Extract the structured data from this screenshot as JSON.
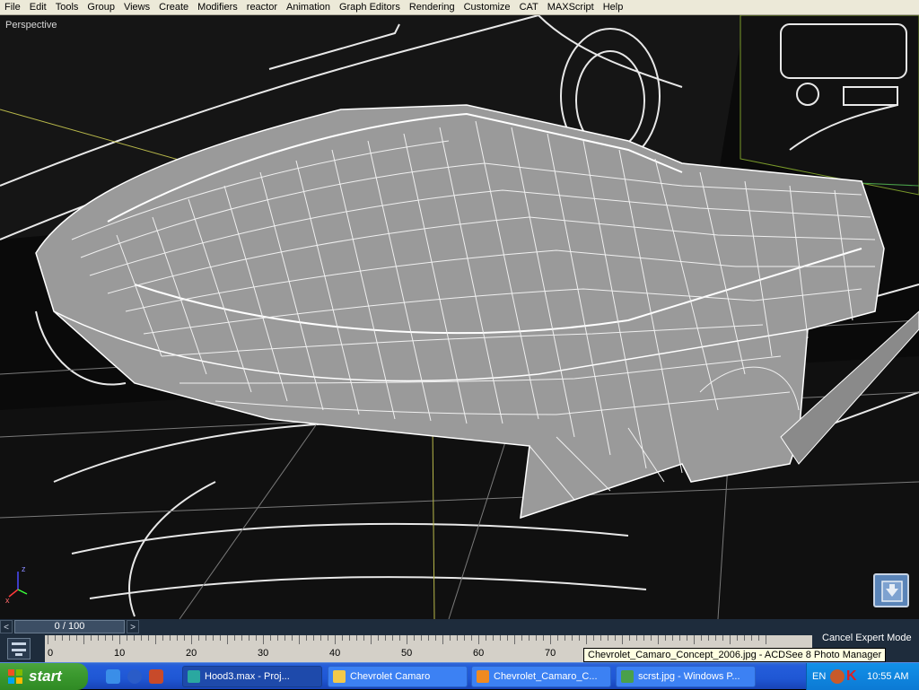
{
  "menu": [
    "File",
    "Edit",
    "Tools",
    "Group",
    "Views",
    "Create",
    "Modifiers",
    "reactor",
    "Animation",
    "Graph Editors",
    "Rendering",
    "Customize",
    "CAT",
    "MAXScript",
    "Help"
  ],
  "viewport": {
    "label": "Perspective"
  },
  "timeslider": {
    "position": "0 / 100",
    "prev": "<",
    "next": ">"
  },
  "trackbar": {
    "ticks": [
      "0",
      "10",
      "20",
      "30",
      "40",
      "50",
      "60",
      "70"
    ]
  },
  "status": {
    "cancel_expert": "Cancel Expert Mode"
  },
  "tooltip": {
    "text": "Chevrolet_Camaro_Concept_2006.jpg - ACDSee 8 Photo Manager"
  },
  "taskbar": {
    "start": "start",
    "buttons": [
      {
        "label": "Hood3.max     - Proj...",
        "icon": "3dsmax-icon",
        "color": "#2aa8a0",
        "active": true
      },
      {
        "label": "Chevrolet Camaro",
        "icon": "folder-icon",
        "color": "#f3c94a",
        "active": false
      },
      {
        "label": "Chevrolet_Camaro_C...",
        "icon": "acdsee-icon",
        "color": "#f08a20",
        "active": false
      },
      {
        "label": "scrst.jpg - Windows P...",
        "icon": "image-viewer-icon",
        "color": "#4aa04a",
        "active": false
      }
    ],
    "language": "EN",
    "clock": "10:55 AM"
  }
}
